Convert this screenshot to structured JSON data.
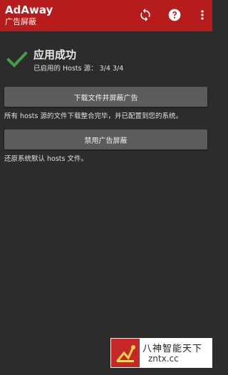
{
  "appbar": {
    "title": "AdAway",
    "subtitle": "广告屏蔽",
    "icons": [
      "refresh-icon",
      "help-icon",
      "more-vert-icon"
    ]
  },
  "status": {
    "title": "应用成功",
    "hosts_line": "已启用的 Hosts 源： 3/4 3/4"
  },
  "actions": {
    "download_label": "下载文件并屏蔽广告",
    "download_desc": "所有 hosts 源的文件下载整合完毕，并已配置到您的系统。",
    "disable_label": "禁用广告屏蔽",
    "disable_desc": "还原系统默认 hosts 文件。"
  },
  "watermark": {
    "text": "八神智能天下",
    "url": "zntx.cc"
  },
  "colors": {
    "appbar": "#b71c1c",
    "background": "#2c2c2c",
    "button": "#5c5c5c",
    "success": "#43a047"
  }
}
